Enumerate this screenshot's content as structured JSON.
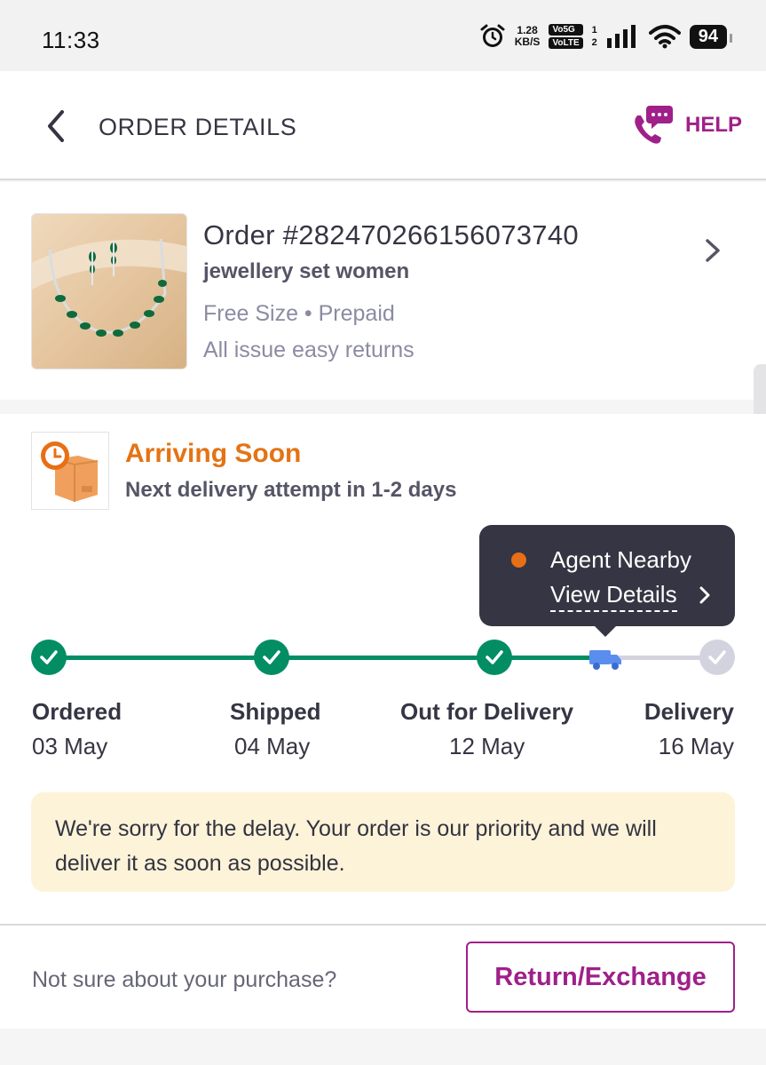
{
  "status_bar": {
    "time": "11:33",
    "speed_value": "1.28",
    "speed_unit": "KB/S",
    "net_top": "Vo5G",
    "net_bottom": "VoLTE",
    "sim_1": "1",
    "sim_2": "2",
    "battery": "94"
  },
  "header": {
    "title": "ORDER DETAILS",
    "help_label": "HELP",
    "accent_color": "#9f2089"
  },
  "order": {
    "id": "Order #282470266156073740",
    "name": "jewellery set women",
    "meta": "Free Size • Prepaid",
    "returns": "All issue easy returns"
  },
  "status": {
    "title": "Arriving Soon",
    "subtitle": "Next delivery attempt in 1-2 days",
    "title_color": "#e47315"
  },
  "agent_tooltip": {
    "title": "Agent Nearby",
    "link": "View Details"
  },
  "tracking": {
    "steps": [
      {
        "label": "Ordered",
        "date": "03 May",
        "state": "done"
      },
      {
        "label": "Shipped",
        "date": "04 May",
        "state": "done"
      },
      {
        "label": "Out for Delivery",
        "date": "12 May",
        "state": "done"
      },
      {
        "label": "Delivery",
        "date": "16 May",
        "state": "pending"
      }
    ],
    "done_color": "#038d63",
    "pending_color": "#d3d3e0"
  },
  "delay_note": "We're sorry for the delay. Your order is our priority and we will deliver it as soon as possible.",
  "bottom": {
    "prompt": "Not sure about your purchase?",
    "button_label": "Return/Exchange"
  }
}
